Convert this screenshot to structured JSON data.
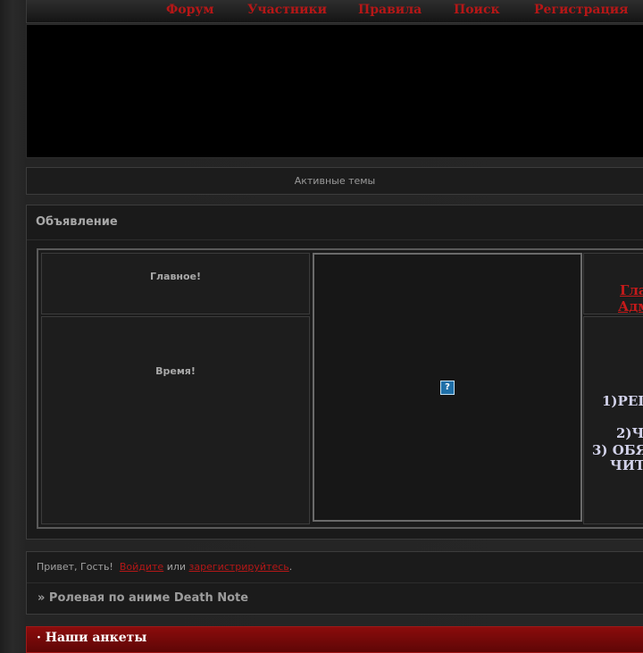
{
  "nav": {
    "items": [
      "Форум",
      "Участники",
      "Правила",
      "Поиск",
      "Регистрация"
    ]
  },
  "active_topics": "Активные темы",
  "announcement": {
    "title": "Объявление",
    "main_label": "Главное!",
    "time_label": "Время!",
    "broken_image_glyph": "?",
    "links": [
      "Гла",
      "Адм"
    ],
    "rules": [
      "1)РЕГ",
      "2)Ч",
      "3) ОБЯ",
      "ЧИТ"
    ]
  },
  "greeting": {
    "prefix": "Привет, Гость!",
    "login": "Войдите",
    "or": "или",
    "register": "зарегистрируйтесь",
    "suffix": "."
  },
  "breadcrumb": "» Ролевая по аниме Death Note",
  "section": {
    "title": "· Наши анкеты"
  },
  "colors": {
    "link_red": "#b51717",
    "header_red": "#8b0c0c",
    "background": "#262626",
    "rules_text": "#d2d2ea"
  }
}
